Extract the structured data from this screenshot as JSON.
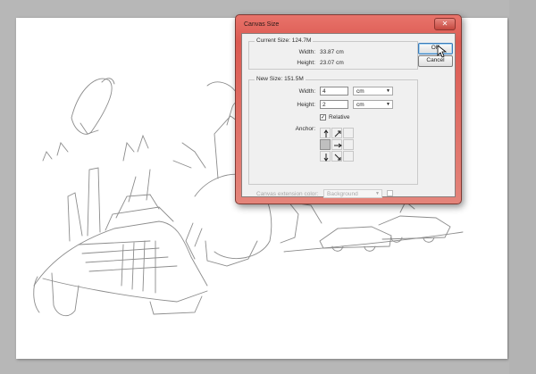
{
  "dialog": {
    "title": "Canvas Size",
    "close_glyph": "✕",
    "current_size": {
      "label": "Current Size: 124.7M",
      "width_label": "Width:",
      "width_value": "33.87 cm",
      "height_label": "Height:",
      "height_value": "23.07 cm"
    },
    "new_size": {
      "label": "New Size: 151.5M",
      "width_label": "Width:",
      "width_value": "4",
      "width_unit": "cm",
      "height_label": "Height:",
      "height_value": "2",
      "height_unit": "cm",
      "relative_label": "Relative",
      "relative_checked": true,
      "anchor_label": "Anchor:",
      "anchor_selected": "middle-left"
    },
    "extension_color_label": "Canvas extension color:",
    "extension_color_value": "Background",
    "ok_label": "OK",
    "cancel_label": "Cancel"
  },
  "icons": {
    "close": "close-icon",
    "dropdown": "chevron-down-icon",
    "check": "checkmark-icon",
    "anchor_arrows": "arrow-icon",
    "cursor": "mouse-pointer-icon"
  },
  "colors": {
    "dialog_frame": "#dc5a52",
    "workspace": "#b7b7b7",
    "canvas": "#ffffff"
  }
}
